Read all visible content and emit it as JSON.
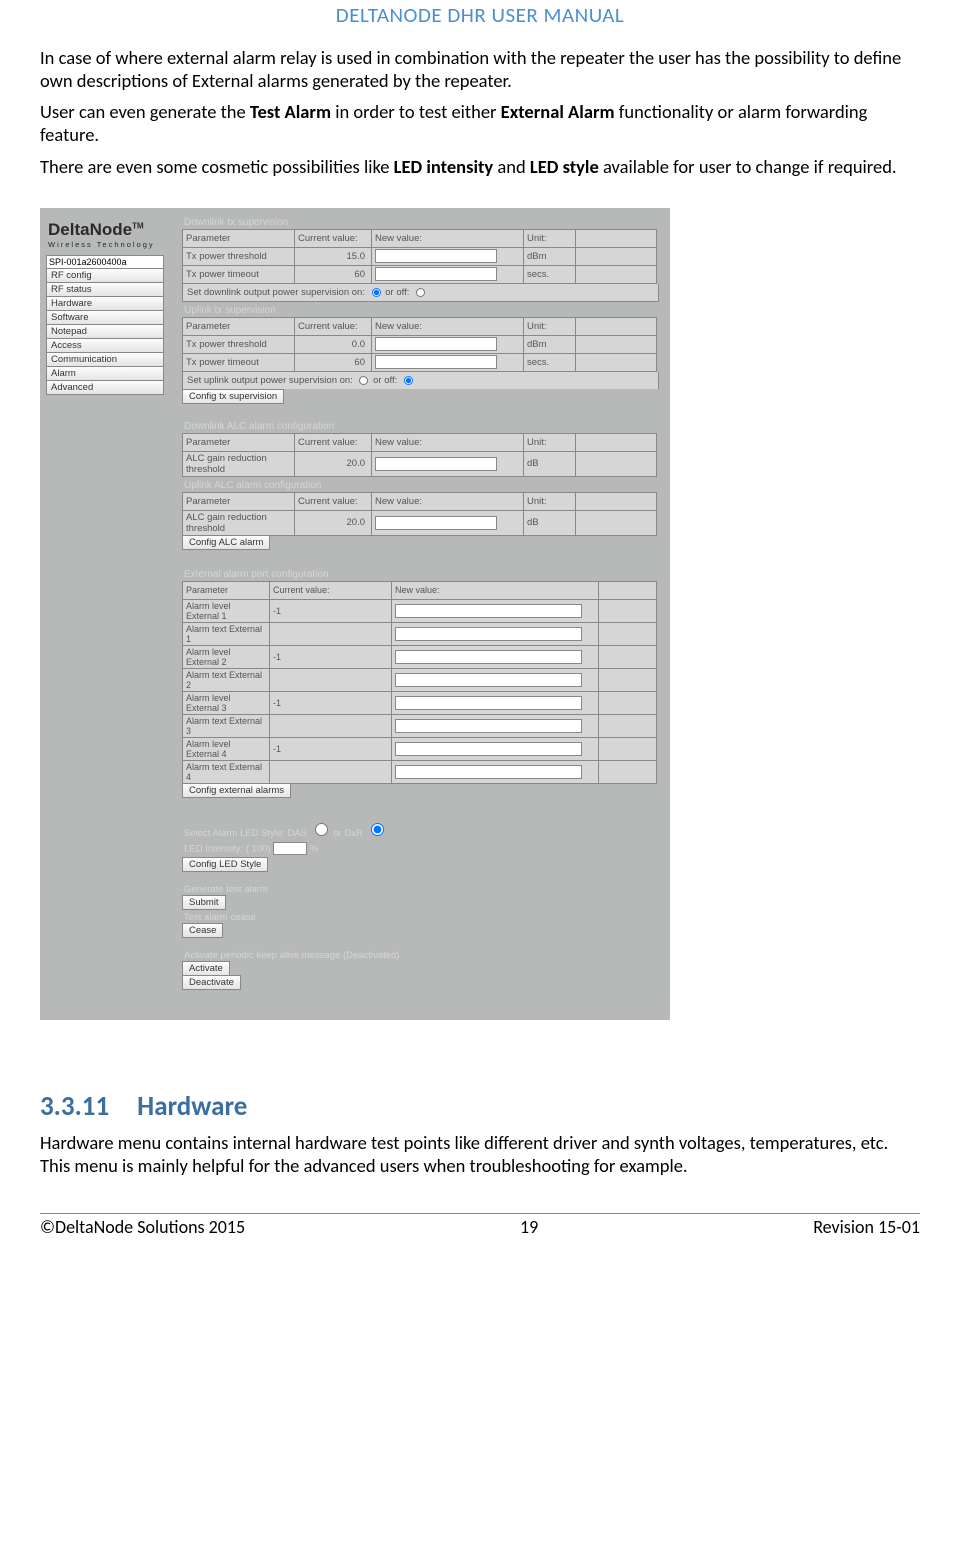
{
  "doc_title": "DELTANODE DHR USER MANUAL",
  "para1_a": "In case of where external alarm relay is used in combination with the repeater the user has the possibility to define own descriptions of External alarms generated by the repeater.",
  "para2_pre": "User can even generate the ",
  "para2_b1": "Test Alarm",
  "para2_mid": " in order to test either ",
  "para2_b2": "External Alarm",
  "para2_post": " functionality or alarm forwarding feature.",
  "para3_pre": "There are even some cosmetic possibilities like ",
  "para3_b1": "LED intensity",
  "para3_mid": " and ",
  "para3_b2": "LED style",
  "para3_post": " available for user to change if required.",
  "logo_main": "DeltaNode",
  "logo_tm": "TM",
  "logo_sub": "Wireless Technology",
  "nav_input_value": "SPI-001a2600400a",
  "nav_items": [
    "RF config",
    "RF status",
    "Hardware",
    "Software",
    "Notepad",
    "Access",
    "Communication",
    "Alarm",
    "Advanced"
  ],
  "sect_downlink_sup": "Downlink tx supervision",
  "hdr_param": "Parameter",
  "hdr_curval": "Current value:",
  "hdr_newval": "New value:",
  "hdr_unit": "Unit:",
  "row_txpow_thresh": "Tx power threshold",
  "row_txpow_timeout": "Tx power timeout",
  "val_15_0": "15.0",
  "val_60a": "60",
  "u_dbm": "dBm",
  "u_secs": "secs.",
  "set_dl_sup": "Set downlink output power supervision on:",
  "or_off": "  or off:",
  "sect_uplink_sup": "Uplink tx supervision",
  "val_0_0": "0.0",
  "val_60b": "60",
  "set_ul_sup": "Set uplink output power supervision on:",
  "btn_config_tx": "Config tx supervision",
  "sect_dl_alc": "Downlink ALC alarm configuration",
  "row_alc": "ALC gain reduction threshold",
  "val_20a": "20.0",
  "u_db": "dB",
  "sect_ul_alc": "Uplink ALC alarm configuration",
  "val_20b": "20.0",
  "btn_config_alc": "Config ALC alarm",
  "sect_ext": "External alarm port configuration",
  "ext_rows": [
    {
      "p": "Alarm level External 1",
      "v": "-1"
    },
    {
      "p": "Alarm text External 1",
      "v": ""
    },
    {
      "p": "Alarm level External 2",
      "v": "-1"
    },
    {
      "p": "Alarm text External 2",
      "v": ""
    },
    {
      "p": "Alarm level External 3",
      "v": "-1"
    },
    {
      "p": "Alarm text External 3",
      "v": ""
    },
    {
      "p": "Alarm level External 4",
      "v": "-1"
    },
    {
      "p": "Alarm text External 4",
      "v": ""
    }
  ],
  "btn_config_ext": "Config external alarms",
  "led_style_label": "Select Alarm LED Style: DAS",
  "led_style_or": "  or DxR",
  "led_intensity_label": "LED Intensity: ( 100)",
  "led_pct": "%",
  "btn_config_led": "Config LED Style",
  "gen_test_label": "Generate test alarm",
  "btn_submit": "Submit",
  "test_cease_label": "Test alarm cease",
  "btn_cease": "Cease",
  "keepalive_label": "Activate periodic keep alive message  (Deactivated)",
  "btn_activate": "Activate",
  "btn_deactivate": "Deactivate",
  "heading_num": "3.3.11",
  "heading_txt": "Hardware",
  "para_hw": "Hardware menu contains internal hardware test points like different driver and synth voltages, temperatures, etc. This menu is mainly helpful for the advanced users when troubleshooting for example.",
  "footer_left": "©DeltaNode Solutions 2015",
  "footer_center": "19",
  "footer_right": "Revision 15-01"
}
